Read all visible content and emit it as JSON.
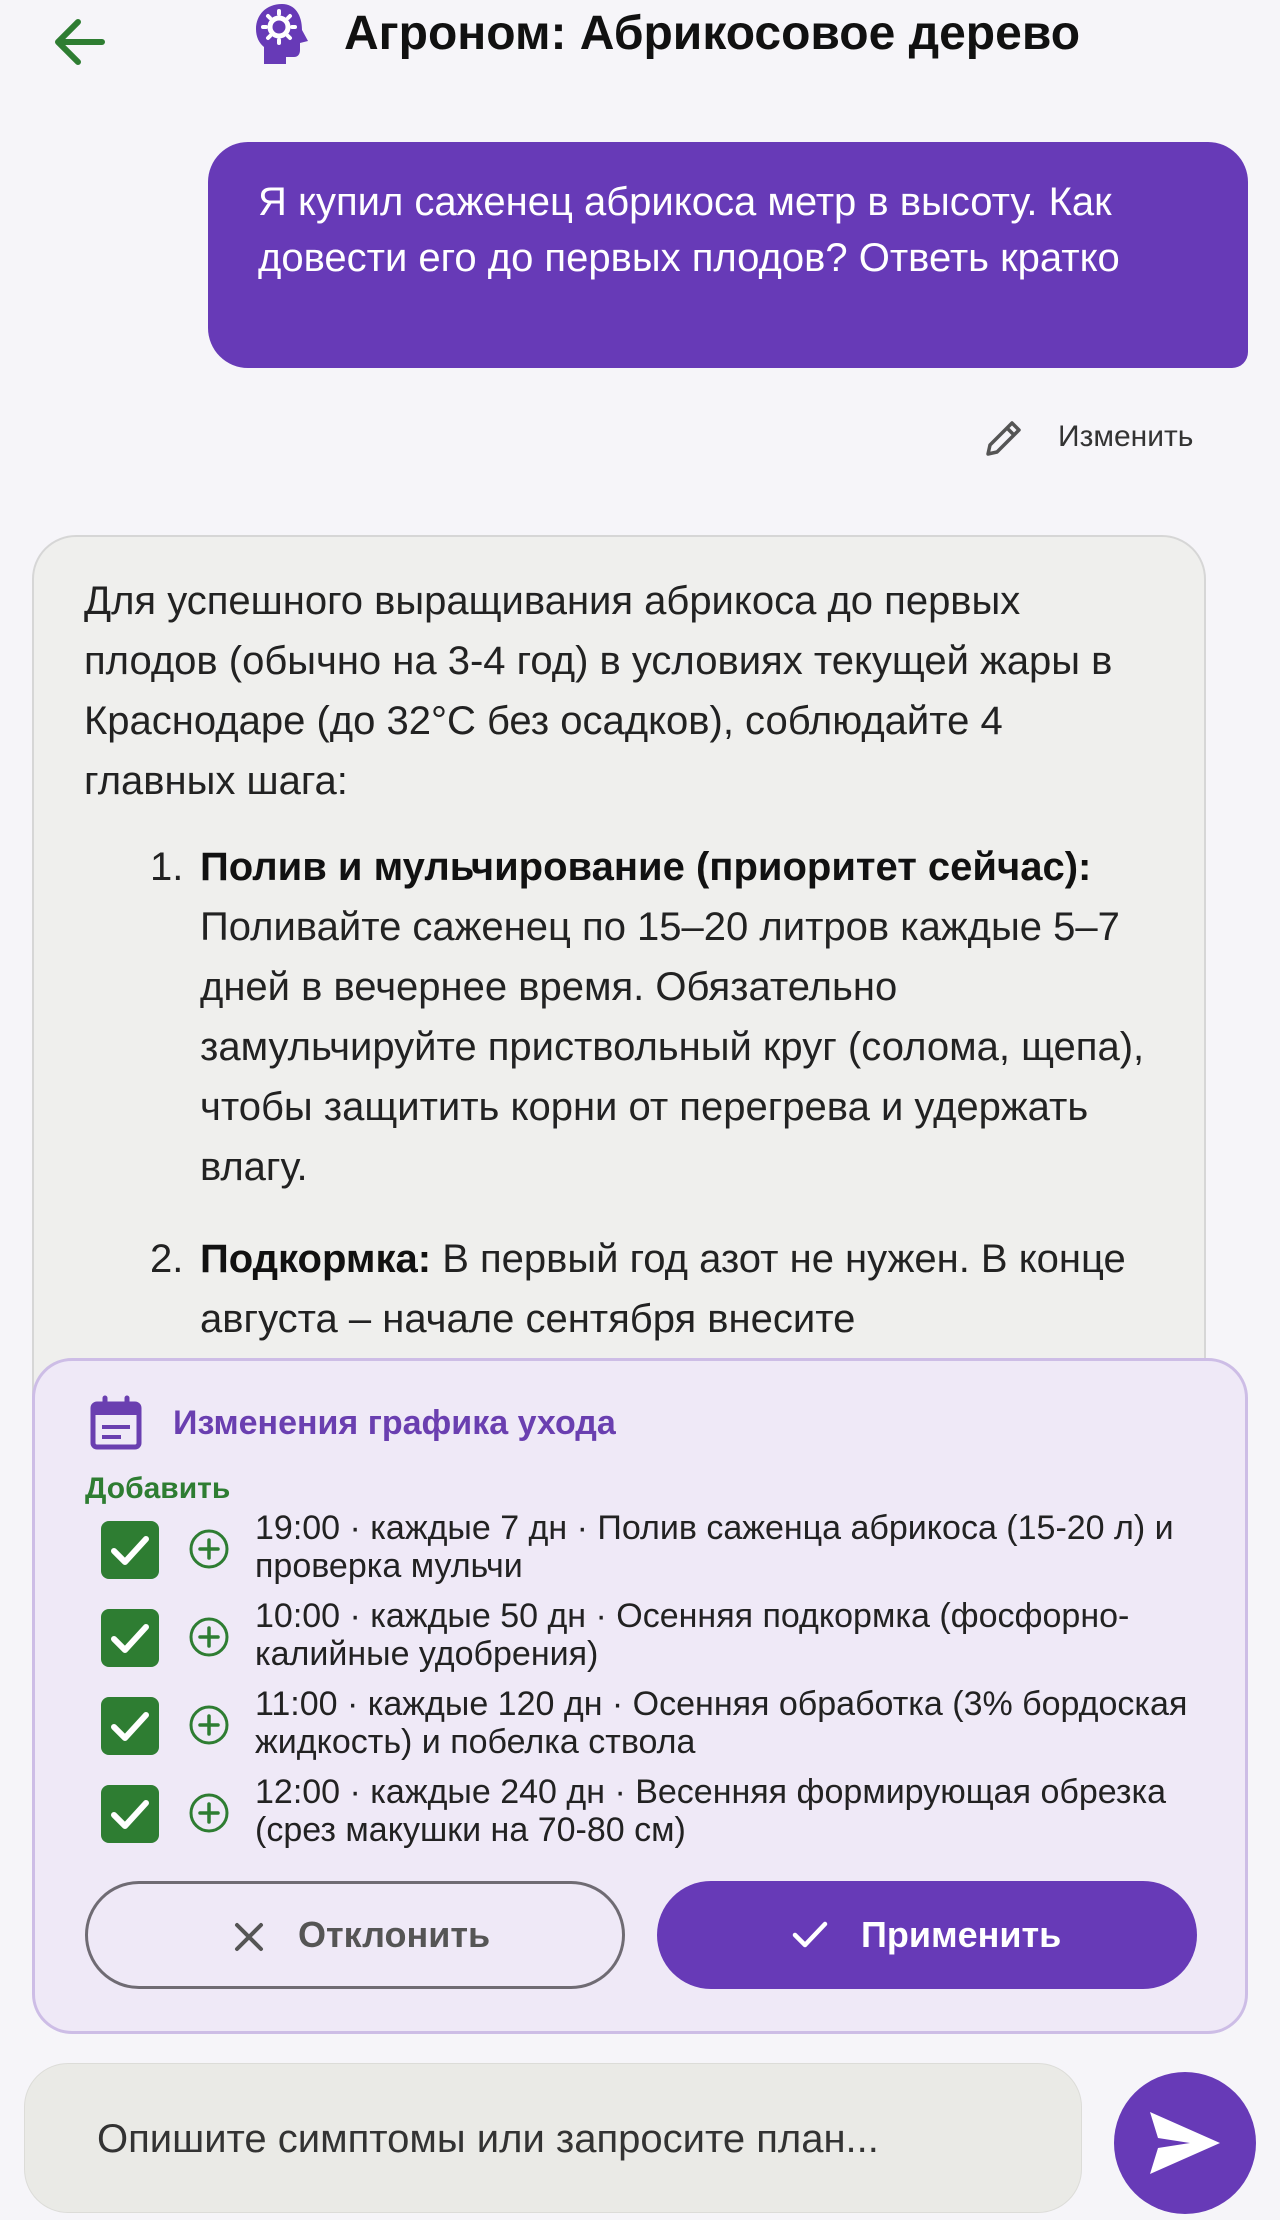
{
  "header": {
    "title": "Агроном: Абрикосовое дерево",
    "back_icon": "arrow-left-icon",
    "agent_icon": "head-gear-icon"
  },
  "user_message": {
    "text": "Я купил саженец абрикоса метр в высоту. Как довести его до первых плодов? Ответь кратко",
    "edit_label": "Изменить"
  },
  "assistant_message": {
    "intro": "Для успешного выращивания абрикоса до первых плодов (обычно на 3-4 год) в условиях текущей жары в Краснодаре (до 32°С без осадков), соблюдайте 4 главных шага:",
    "items": [
      {
        "number": "1.",
        "heading": "Полив и мульчирование (приоритет сейчас):",
        "text": "Поливайте саженец по 15–20 литров каждые 5–7 дней в вечернее время. Обязательно замульчируйте приствольный круг (солома, щепа), чтобы защитить корни от перегрева и удержать влагу."
      },
      {
        "number": "2.",
        "heading": "Подкормка:",
        "text": "В первый год азот не нужен. В конце августа – начале сентября внесите"
      }
    ]
  },
  "schedule_card": {
    "title": "Изменения графика ухода",
    "add_label": "Добавить",
    "items": [
      {
        "text": "19:00 · каждые 7 дн · Полив саженца абрикоса (15-20 л) и проверка мульчи",
        "checked": true
      },
      {
        "text": "10:00 · каждые 50 дн · Осенняя подкормка (фосфорно-калийные удобрения)",
        "checked": true
      },
      {
        "text": "11:00 · каждые 120 дн · Осенняя обработка (3% бордоская жидкость) и побелка ствола",
        "checked": true
      },
      {
        "text": "12:00 · каждые 240 дн · Весенняя формирующая обрезка (срез макушки на 70-80 см)",
        "checked": true
      }
    ],
    "reject_label": "Отклонить",
    "apply_label": "Применить"
  },
  "composer": {
    "placeholder": "Опишите симптомы или запросите план..."
  },
  "colors": {
    "accent": "#673ab7",
    "green": "#2e7d32",
    "card_bg": "#efe9f7"
  }
}
